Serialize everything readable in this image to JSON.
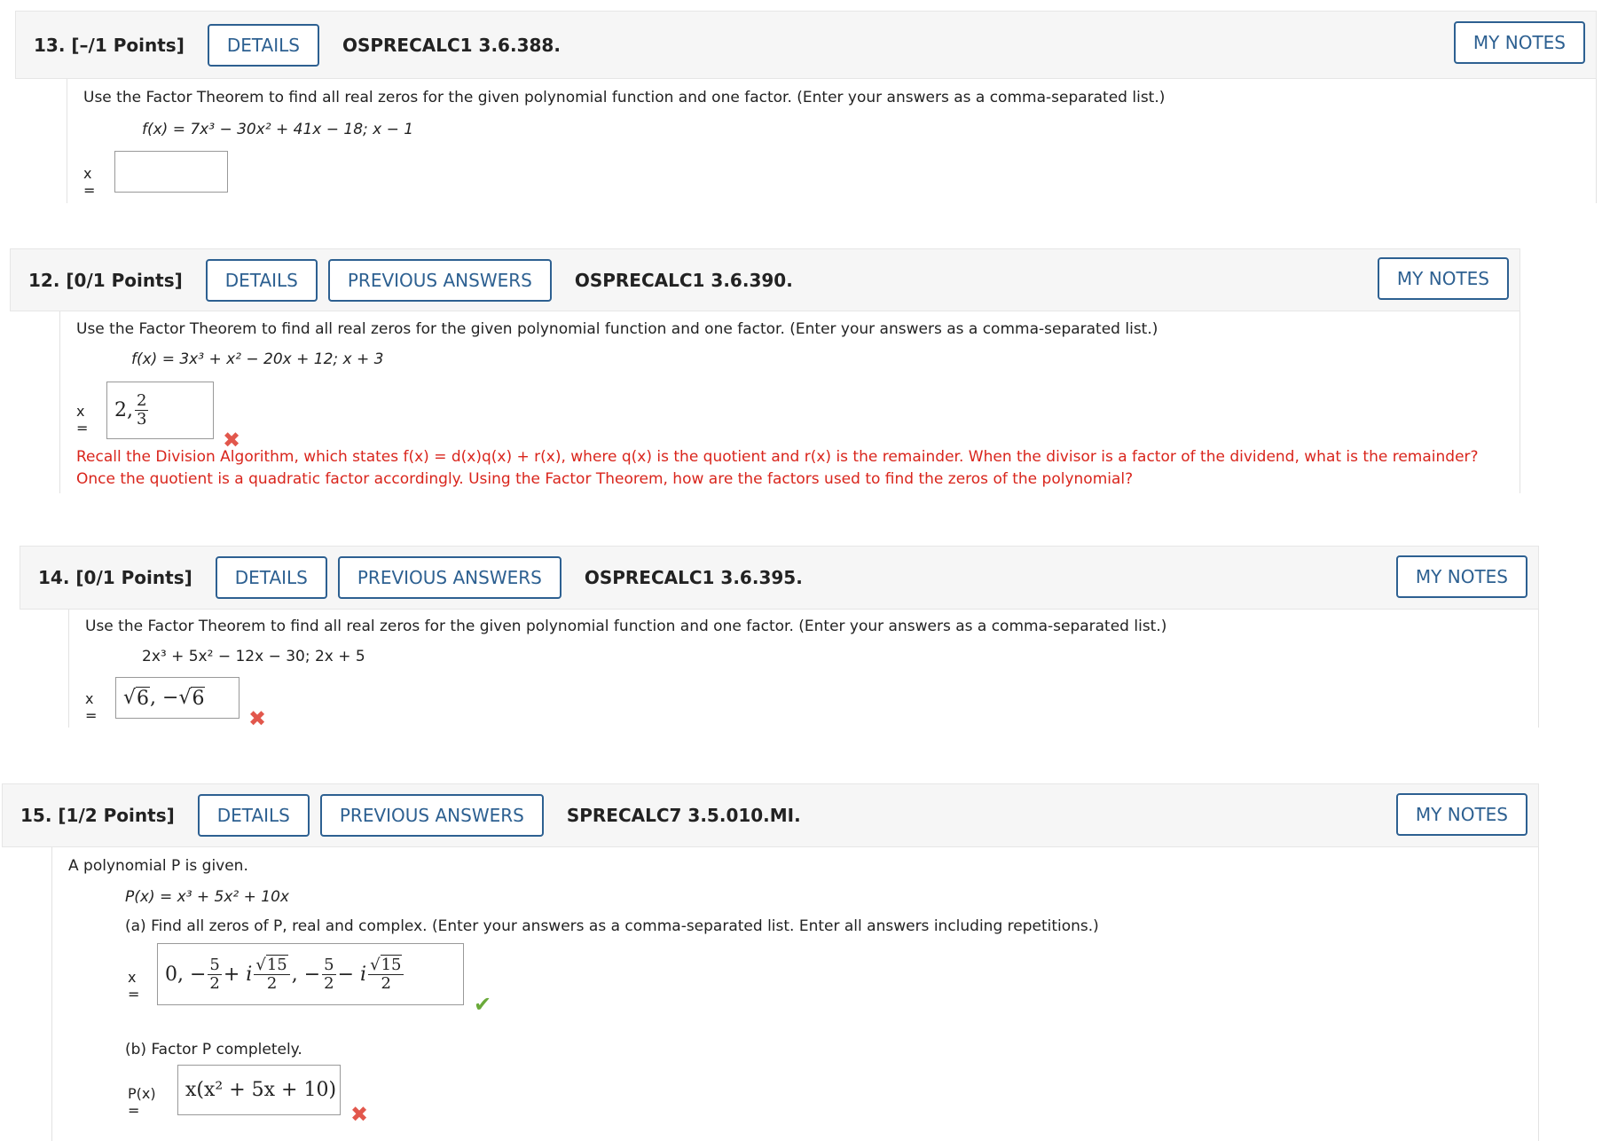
{
  "common": {
    "details": "DETAILS",
    "previous_answers": "PREVIOUS ANSWERS",
    "my_notes": "MY NOTES",
    "prompt": "Use the Factor Theorem to find all real zeros for the given polynomial function and one factor. (Enter your answers as a comma-separated list.)",
    "x_label": "x =",
    "x_mark": "✖",
    "check_mark": "✔"
  },
  "q13": {
    "num": "13.",
    "points": "[–/1 Points]",
    "code": "OSPRECALC1 3.6.388.",
    "function": "f(x) = 7x³ − 30x² + 41x − 18;    x − 1",
    "answer": ""
  },
  "q12": {
    "num": "12.",
    "points": "[0/1 Points]",
    "code": "OSPRECALC1 3.6.390.",
    "function": "f(x) = 3x³ + x² − 20x + 12;    x + 3",
    "answer_lead": "2,",
    "answer_num": "2",
    "answer_den": "3",
    "feedback": "Recall the Division Algorithm, which states f(x) = d(x)q(x) + r(x), where q(x) is the quotient and r(x) is the remainder. When the divisor is a factor of the dividend, what is the remainder? Once the quotient is a quadratic factor accordingly. Using the Factor Theorem, how are the factors used to find the zeros of the polynomial?"
  },
  "q14": {
    "num": "14.",
    "points": "[0/1 Points]",
    "code": "OSPRECALC1 3.6.395.",
    "function": "2x³ + 5x² − 12x − 30;    2x + 5",
    "answer_rad1": "6",
    "answer_sep": ", −",
    "answer_rad2": "6"
  },
  "q15": {
    "num": "15.",
    "points": "[1/2 Points]",
    "code": "SPRECALC7 3.5.010.MI.",
    "intro": "A polynomial P is given.",
    "function": "P(x) = x³ + 5x² + 10x",
    "part_a": "(a) Find all zeros of P, real and complex. (Enter your answers as a comma-separated list. Enter all answers including repetitions.)",
    "part_a_lead": "0, −",
    "frac_5": "5",
    "frac_2": "2",
    "i_plus": "+ i",
    "rad_15": "15",
    "sep_minus": ", −",
    "i_minus": "− i",
    "part_b": "(b) Factor P completely.",
    "p_label": "P(x) =",
    "part_b_answer": "x(x² + 5x + 10)"
  }
}
